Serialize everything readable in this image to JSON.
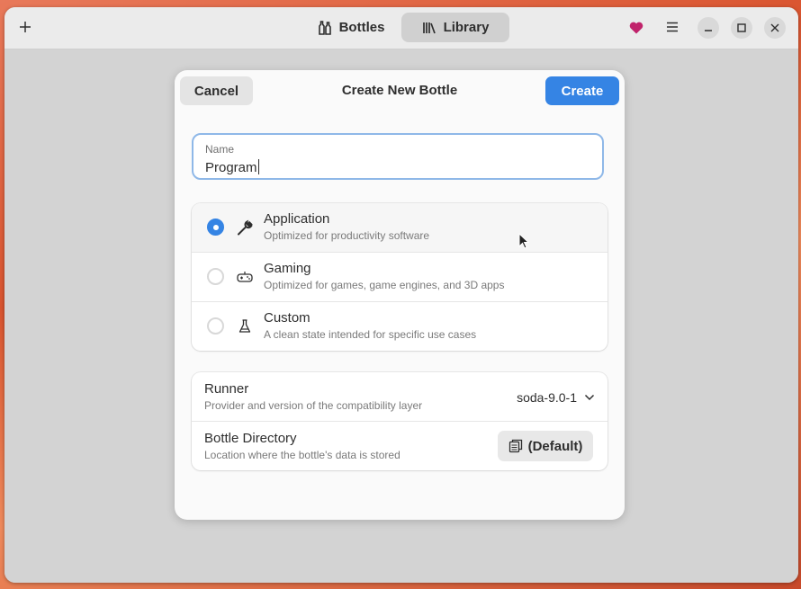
{
  "header": {
    "add_icon": "plus-icon",
    "tabs": [
      {
        "label": "Bottles",
        "icon": "bottles-icon",
        "active": false
      },
      {
        "label": "Library",
        "icon": "library-icon",
        "active": true
      }
    ],
    "heart_icon": "heart-icon",
    "heart_color": "#c0236b",
    "menu_icon": "hamburger-menu-icon",
    "window_controls": [
      "minimize-icon",
      "maximize-icon",
      "close-icon"
    ]
  },
  "dialog": {
    "cancel_label": "Cancel",
    "title": "Create New Bottle",
    "create_label": "Create",
    "accent": "#3584e4",
    "name_field": {
      "label": "Name",
      "value": "Program"
    },
    "environments": [
      {
        "title": "Application",
        "subtitle": "Optimized for productivity software",
        "icon": "wrench-icon",
        "selected": true
      },
      {
        "title": "Gaming",
        "subtitle": "Optimized for games, game engines, and 3D apps",
        "icon": "gamepad-icon",
        "selected": false
      },
      {
        "title": "Custom",
        "subtitle": "A clean state intended for specific use cases",
        "icon": "flask-icon",
        "selected": false
      }
    ],
    "runner": {
      "title": "Runner",
      "subtitle": "Provider and version of the compatibility layer",
      "value": "soda-9.0-1"
    },
    "directory": {
      "title": "Bottle Directory",
      "subtitle": "Location where the bottle's data is stored",
      "button_label": "(Default)",
      "icon": "folder-copy-icon"
    }
  }
}
